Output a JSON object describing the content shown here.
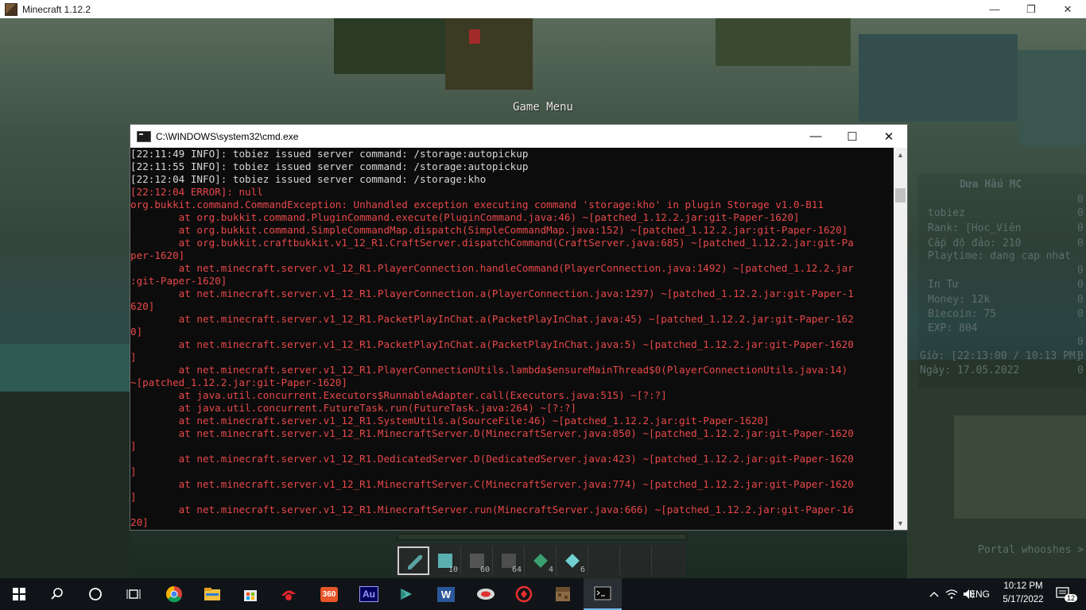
{
  "mc_window": {
    "title": "Minecraft 1.12.2",
    "controls": {
      "minimize": "—",
      "restore": "❐",
      "close": "✕"
    }
  },
  "game": {
    "menu_label": "Game Menu",
    "scoreboard": {
      "title": "Dưa Hấu MC",
      "lines": [
        "tobiez",
        "Rank: [Hoc_Viên",
        "Cấp độ đảo: 210",
        "Playtime: dang cap nhat",
        "",
        "In Tư",
        "Money: 12k",
        "Biecoin: 75",
        "EXP: 804",
        "",
        "Giờ: [22:13:00 / 10:13 PM]",
        "Ngày: 17.05.2022"
      ],
      "scores": [
        "0",
        "0",
        "0",
        "0",
        "0",
        "0",
        "0",
        "0",
        "0",
        "0",
        "0",
        "0"
      ]
    },
    "subtitle": "Portal whooshes >",
    "hotbar": {
      "slots": [
        {
          "icon": "pickaxe-icon",
          "count": ""
        },
        {
          "icon": "diamond-block-icon",
          "count": "10"
        },
        {
          "icon": "cobblestone-icon",
          "count": "60"
        },
        {
          "icon": "cobblestone-icon",
          "count": "64"
        },
        {
          "icon": "emerald-icon",
          "count": "4"
        },
        {
          "icon": "diamond-icon",
          "count": "6"
        },
        {
          "icon": "",
          "count": ""
        },
        {
          "icon": "",
          "count": ""
        },
        {
          "icon": "",
          "count": ""
        }
      ]
    }
  },
  "cmd_window": {
    "title": "C:\\WINDOWS\\system32\\cmd.exe",
    "controls": {
      "minimize": "—",
      "maximize": "☐",
      "close": "✕"
    },
    "lines": [
      {
        "t": "info",
        "text": "[22:11:49 INFO]: tobiez issued server command: /storage:autopickup"
      },
      {
        "t": "info",
        "text": "[22:11:55 INFO]: tobiez issued server command: /storage:autopickup"
      },
      {
        "t": "info",
        "text": "[22:12:04 INFO]: tobiez issued server command: /storage:kho"
      },
      {
        "t": "err",
        "text": "[22:12:04 ERROR]: null"
      },
      {
        "t": "err",
        "text": "org.bukkit.command.CommandException: Unhandled exception executing command 'storage:kho' in plugin Storage v1.0-B11"
      },
      {
        "t": "err",
        "text": "        at org.bukkit.command.PluginCommand.execute(PluginCommand.java:46) ~[patched_1.12.2.jar:git-Paper-1620]"
      },
      {
        "t": "err",
        "text": "        at org.bukkit.command.SimpleCommandMap.dispatch(SimpleCommandMap.java:152) ~[patched_1.12.2.jar:git-Paper-1620]"
      },
      {
        "t": "err",
        "text": "        at org.bukkit.craftbukkit.v1_12_R1.CraftServer.dispatchCommand(CraftServer.java:685) ~[patched_1.12.2.jar:git-Pa"
      },
      {
        "t": "err",
        "text": "per-1620]"
      },
      {
        "t": "err",
        "text": "        at net.minecraft.server.v1_12_R1.PlayerConnection.handleCommand(PlayerConnection.java:1492) ~[patched_1.12.2.jar"
      },
      {
        "t": "err",
        "text": ":git-Paper-1620]"
      },
      {
        "t": "err",
        "text": "        at net.minecraft.server.v1_12_R1.PlayerConnection.a(PlayerConnection.java:1297) ~[patched_1.12.2.jar:git-Paper-1"
      },
      {
        "t": "err",
        "text": "620]"
      },
      {
        "t": "err",
        "text": "        at net.minecraft.server.v1_12_R1.PacketPlayInChat.a(PacketPlayInChat.java:45) ~[patched_1.12.2.jar:git-Paper-162"
      },
      {
        "t": "err",
        "text": "0]"
      },
      {
        "t": "err",
        "text": "        at net.minecraft.server.v1_12_R1.PacketPlayInChat.a(PacketPlayInChat.java:5) ~[patched_1.12.2.jar:git-Paper-1620"
      },
      {
        "t": "err",
        "text": "]"
      },
      {
        "t": "err",
        "text": "        at net.minecraft.server.v1_12_R1.PlayerConnectionUtils.lambda$ensureMainThread$0(PlayerConnectionUtils.java:14)"
      },
      {
        "t": "err",
        "text": "~[patched_1.12.2.jar:git-Paper-1620]"
      },
      {
        "t": "err",
        "text": "        at java.util.concurrent.Executors$RunnableAdapter.call(Executors.java:515) ~[?:?]"
      },
      {
        "t": "err",
        "text": "        at java.util.concurrent.FutureTask.run(FutureTask.java:264) ~[?:?]"
      },
      {
        "t": "err",
        "text": "        at net.minecraft.server.v1_12_R1.SystemUtils.a(SourceFile:46) ~[patched_1.12.2.jar:git-Paper-1620]"
      },
      {
        "t": "err",
        "text": "        at net.minecraft.server.v1_12_R1.MinecraftServer.D(MinecraftServer.java:850) ~[patched_1.12.2.jar:git-Paper-1620"
      },
      {
        "t": "err",
        "text": "]"
      },
      {
        "t": "err",
        "text": "        at net.minecraft.server.v1_12_R1.DedicatedServer.D(DedicatedServer.java:423) ~[patched_1.12.2.jar:git-Paper-1620"
      },
      {
        "t": "err",
        "text": "]"
      },
      {
        "t": "err",
        "text": "        at net.minecraft.server.v1_12_R1.MinecraftServer.C(MinecraftServer.java:774) ~[patched_1.12.2.jar:git-Paper-1620"
      },
      {
        "t": "err",
        "text": "]"
      },
      {
        "t": "err",
        "text": "        at net.minecraft.server.v1_12_R1.MinecraftServer.run(MinecraftServer.java:666) ~[patched_1.12.2.jar:git-Paper-16"
      },
      {
        "t": "err",
        "text": "20]"
      }
    ]
  },
  "taskbar": {
    "apps": [
      {
        "name": "task-view-icon"
      },
      {
        "name": "chrome-icon"
      },
      {
        "name": "file-explorer-icon"
      },
      {
        "name": "microsoft-store-icon"
      },
      {
        "name": "garena-icon"
      },
      {
        "name": "360-security-icon",
        "label": "360"
      },
      {
        "name": "audition-icon",
        "label": "Au"
      },
      {
        "name": "filmora-icon"
      },
      {
        "name": "word-icon",
        "label": "W"
      },
      {
        "name": "wifi-app-icon"
      },
      {
        "name": "app-red-icon"
      },
      {
        "name": "minecraft-icon"
      },
      {
        "name": "cmd-icon"
      }
    ],
    "tray": {
      "language": "ENG",
      "time": "10:12 PM",
      "date": "5/17/2022",
      "notifications": "12"
    }
  },
  "colors": {
    "console_bg": "#0c0c0c",
    "console_error": "#e8484a",
    "console_info": "#d8d8d8",
    "taskbar_bg": "#101418",
    "accent": "#76b9ed"
  }
}
